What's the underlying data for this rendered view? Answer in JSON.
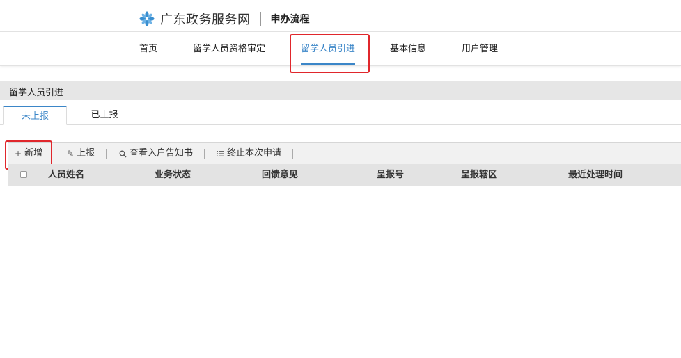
{
  "header": {
    "brand": "广东政务服务网",
    "sub_title": "申办流程"
  },
  "nav": {
    "items": [
      {
        "label": "首页"
      },
      {
        "label": "留学人员资格审定"
      },
      {
        "label": "留学人员引进",
        "active": true
      },
      {
        "label": "基本信息"
      },
      {
        "label": "用户管理"
      }
    ]
  },
  "section": {
    "title": "留学人员引进"
  },
  "tabs": [
    {
      "label": "未上报",
      "active": true
    },
    {
      "label": "已上报"
    }
  ],
  "toolbar": {
    "add": {
      "icon": "+",
      "label": "新增"
    },
    "report": {
      "icon": "✎",
      "label": "上报"
    },
    "view_notice": {
      "icon": "🔍",
      "label": "查看入户告知书"
    },
    "terminate": {
      "icon": "☷",
      "label": "终止本次申请"
    }
  },
  "table": {
    "columns": [
      "人员姓名",
      "业务状态",
      "回馈意见",
      "呈报号",
      "呈报辖区",
      "最近处理时间"
    ],
    "rows": []
  },
  "colors": {
    "accent": "#3b86c8",
    "highlight": "#e0272c",
    "logo": "#3a8fd0"
  }
}
